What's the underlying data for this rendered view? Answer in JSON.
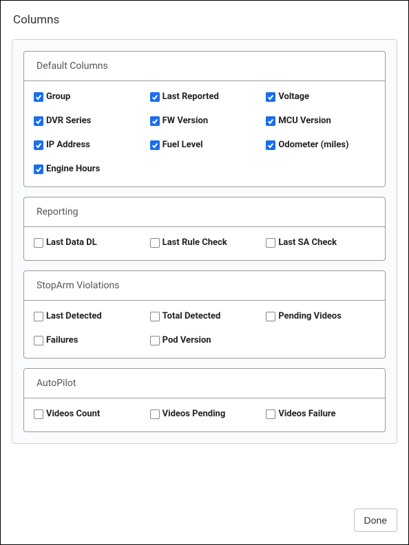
{
  "dialog": {
    "title": "Columns",
    "done_label": "Done"
  },
  "sections": [
    {
      "title": "Default Columns",
      "items": [
        {
          "label": "Group",
          "checked": true
        },
        {
          "label": "Last Reported",
          "checked": true
        },
        {
          "label": "Voltage",
          "checked": true
        },
        {
          "label": "DVR Series",
          "checked": true
        },
        {
          "label": "FW Version",
          "checked": true
        },
        {
          "label": "MCU Version",
          "checked": true
        },
        {
          "label": "IP Address",
          "checked": true
        },
        {
          "label": "Fuel Level",
          "checked": true
        },
        {
          "label": "Odometer (miles)",
          "checked": true
        },
        {
          "label": "Engine Hours",
          "checked": true
        }
      ]
    },
    {
      "title": "Reporting",
      "items": [
        {
          "label": "Last Data DL",
          "checked": false
        },
        {
          "label": "Last Rule Check",
          "checked": false
        },
        {
          "label": "Last SA Check",
          "checked": false
        }
      ]
    },
    {
      "title": "StopArm Violations",
      "items": [
        {
          "label": "Last Detected",
          "checked": false
        },
        {
          "label": "Total Detected",
          "checked": false
        },
        {
          "label": "Pending Videos",
          "checked": false
        },
        {
          "label": "Failures",
          "checked": false
        },
        {
          "label": "Pod Version",
          "checked": false
        }
      ]
    },
    {
      "title": "AutoPilot",
      "items": [
        {
          "label": "Videos Count",
          "checked": false
        },
        {
          "label": "Videos Pending",
          "checked": false
        },
        {
          "label": "Videos Failure",
          "checked": false
        }
      ]
    }
  ]
}
